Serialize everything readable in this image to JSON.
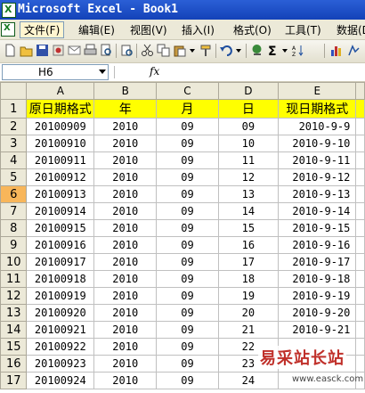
{
  "window": {
    "title": "Microsoft Excel - Book1"
  },
  "menu": {
    "items": [
      "文件(F)",
      "编辑(E)",
      "视图(V)",
      "插入(I)",
      "格式(O)",
      "工具(T)",
      "数据(D)"
    ]
  },
  "formula_bar": {
    "name_box": "H6",
    "fx_label": "fx",
    "content": ""
  },
  "sheet": {
    "columns": [
      "A",
      "B",
      "C",
      "D",
      "E"
    ],
    "selected_row": "6",
    "rows": [
      {
        "num": "1",
        "cells": [
          "原日期格式",
          "年",
          "月",
          "日",
          "现日期格式"
        ]
      },
      {
        "num": "2",
        "cells": [
          "20100909",
          "2010",
          "09",
          "09",
          "2010-9-9"
        ]
      },
      {
        "num": "3",
        "cells": [
          "20100910",
          "2010",
          "09",
          "10",
          "2010-9-10"
        ]
      },
      {
        "num": "4",
        "cells": [
          "20100911",
          "2010",
          "09",
          "11",
          "2010-9-11"
        ]
      },
      {
        "num": "5",
        "cells": [
          "20100912",
          "2010",
          "09",
          "12",
          "2010-9-12"
        ]
      },
      {
        "num": "6",
        "cells": [
          "20100913",
          "2010",
          "09",
          "13",
          "2010-9-13"
        ]
      },
      {
        "num": "7",
        "cells": [
          "20100914",
          "2010",
          "09",
          "14",
          "2010-9-14"
        ]
      },
      {
        "num": "8",
        "cells": [
          "20100915",
          "2010",
          "09",
          "15",
          "2010-9-15"
        ]
      },
      {
        "num": "9",
        "cells": [
          "20100916",
          "2010",
          "09",
          "16",
          "2010-9-16"
        ]
      },
      {
        "num": "10",
        "cells": [
          "20100917",
          "2010",
          "09",
          "17",
          "2010-9-17"
        ]
      },
      {
        "num": "11",
        "cells": [
          "20100918",
          "2010",
          "09",
          "18",
          "2010-9-18"
        ]
      },
      {
        "num": "12",
        "cells": [
          "20100919",
          "2010",
          "09",
          "19",
          "2010-9-19"
        ]
      },
      {
        "num": "13",
        "cells": [
          "20100920",
          "2010",
          "09",
          "20",
          "2010-9-20"
        ]
      },
      {
        "num": "14",
        "cells": [
          "20100921",
          "2010",
          "09",
          "21",
          "2010-9-21"
        ]
      },
      {
        "num": "15",
        "cells": [
          "20100922",
          "2010",
          "09",
          "22",
          ""
        ]
      },
      {
        "num": "16",
        "cells": [
          "20100923",
          "2010",
          "09",
          "23",
          ""
        ]
      },
      {
        "num": "17",
        "cells": [
          "20100924",
          "2010",
          "09",
          "24",
          ""
        ]
      }
    ]
  },
  "watermark": {
    "text": "易采站长站",
    "url": "www.easck.com"
  },
  "colors": {
    "header_fill": "#ffff00",
    "selected_row_header": "#f8b65a",
    "title_bar": "#1342b8"
  }
}
